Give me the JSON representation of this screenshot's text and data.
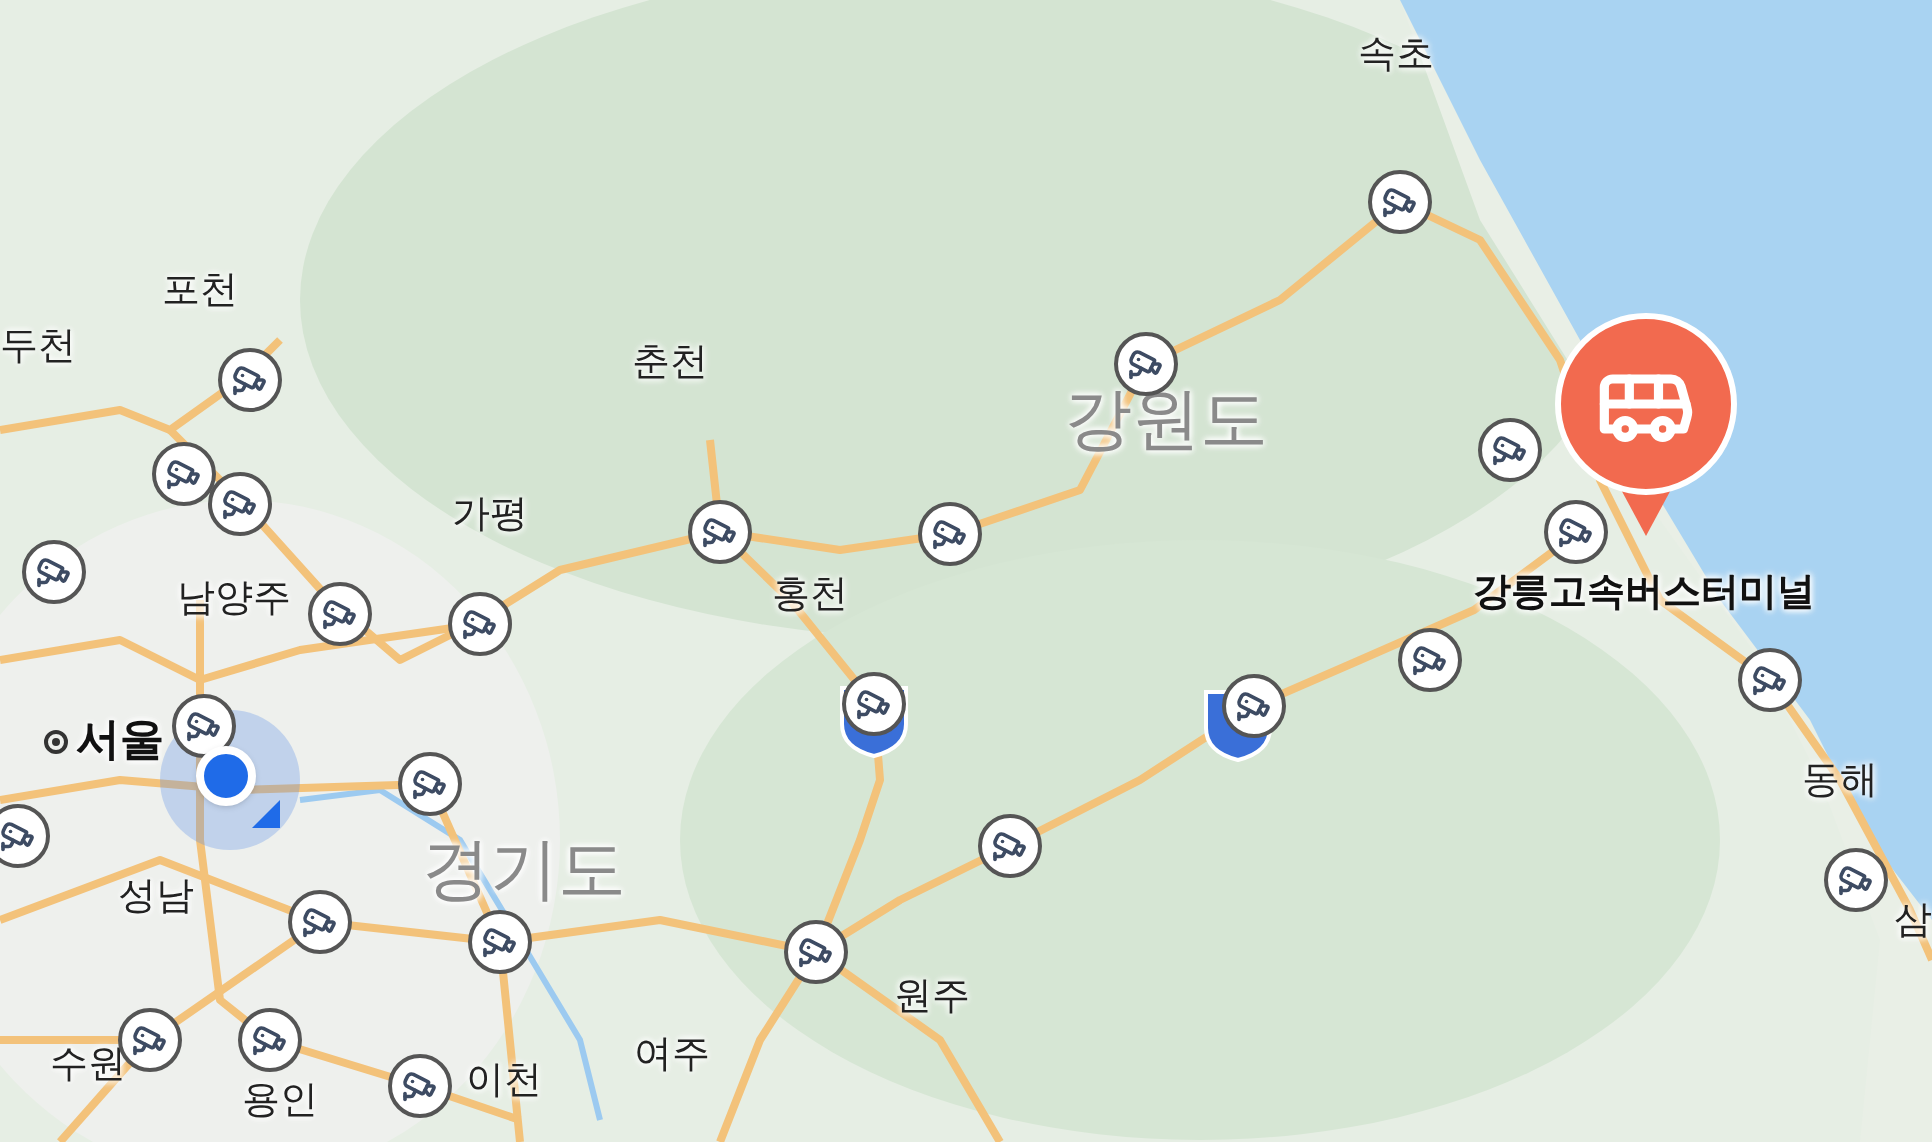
{
  "map": {
    "labels": [
      {
        "text": "속초",
        "kind": "city"
      },
      {
        "text": "두천",
        "kind": "city"
      },
      {
        "text": "포천",
        "kind": "city"
      },
      {
        "text": "춘천",
        "kind": "city"
      },
      {
        "text": "강원도",
        "kind": "province"
      },
      {
        "text": "가평",
        "kind": "city"
      },
      {
        "text": "남양주",
        "kind": "city"
      },
      {
        "text": "홍천",
        "kind": "city"
      },
      {
        "text": "강릉고속버스터미널",
        "kind": "poi"
      },
      {
        "text": "서울",
        "kind": "capital"
      },
      {
        "text": "동해",
        "kind": "city"
      },
      {
        "text": "성남",
        "kind": "city"
      },
      {
        "text": "경기도",
        "kind": "province"
      },
      {
        "text": "삼",
        "kind": "city"
      },
      {
        "text": "원주",
        "kind": "city"
      },
      {
        "text": "수원",
        "kind": "city"
      },
      {
        "text": "용인",
        "kind": "city"
      },
      {
        "text": "이천",
        "kind": "city"
      },
      {
        "text": "여주",
        "kind": "city"
      }
    ]
  }
}
